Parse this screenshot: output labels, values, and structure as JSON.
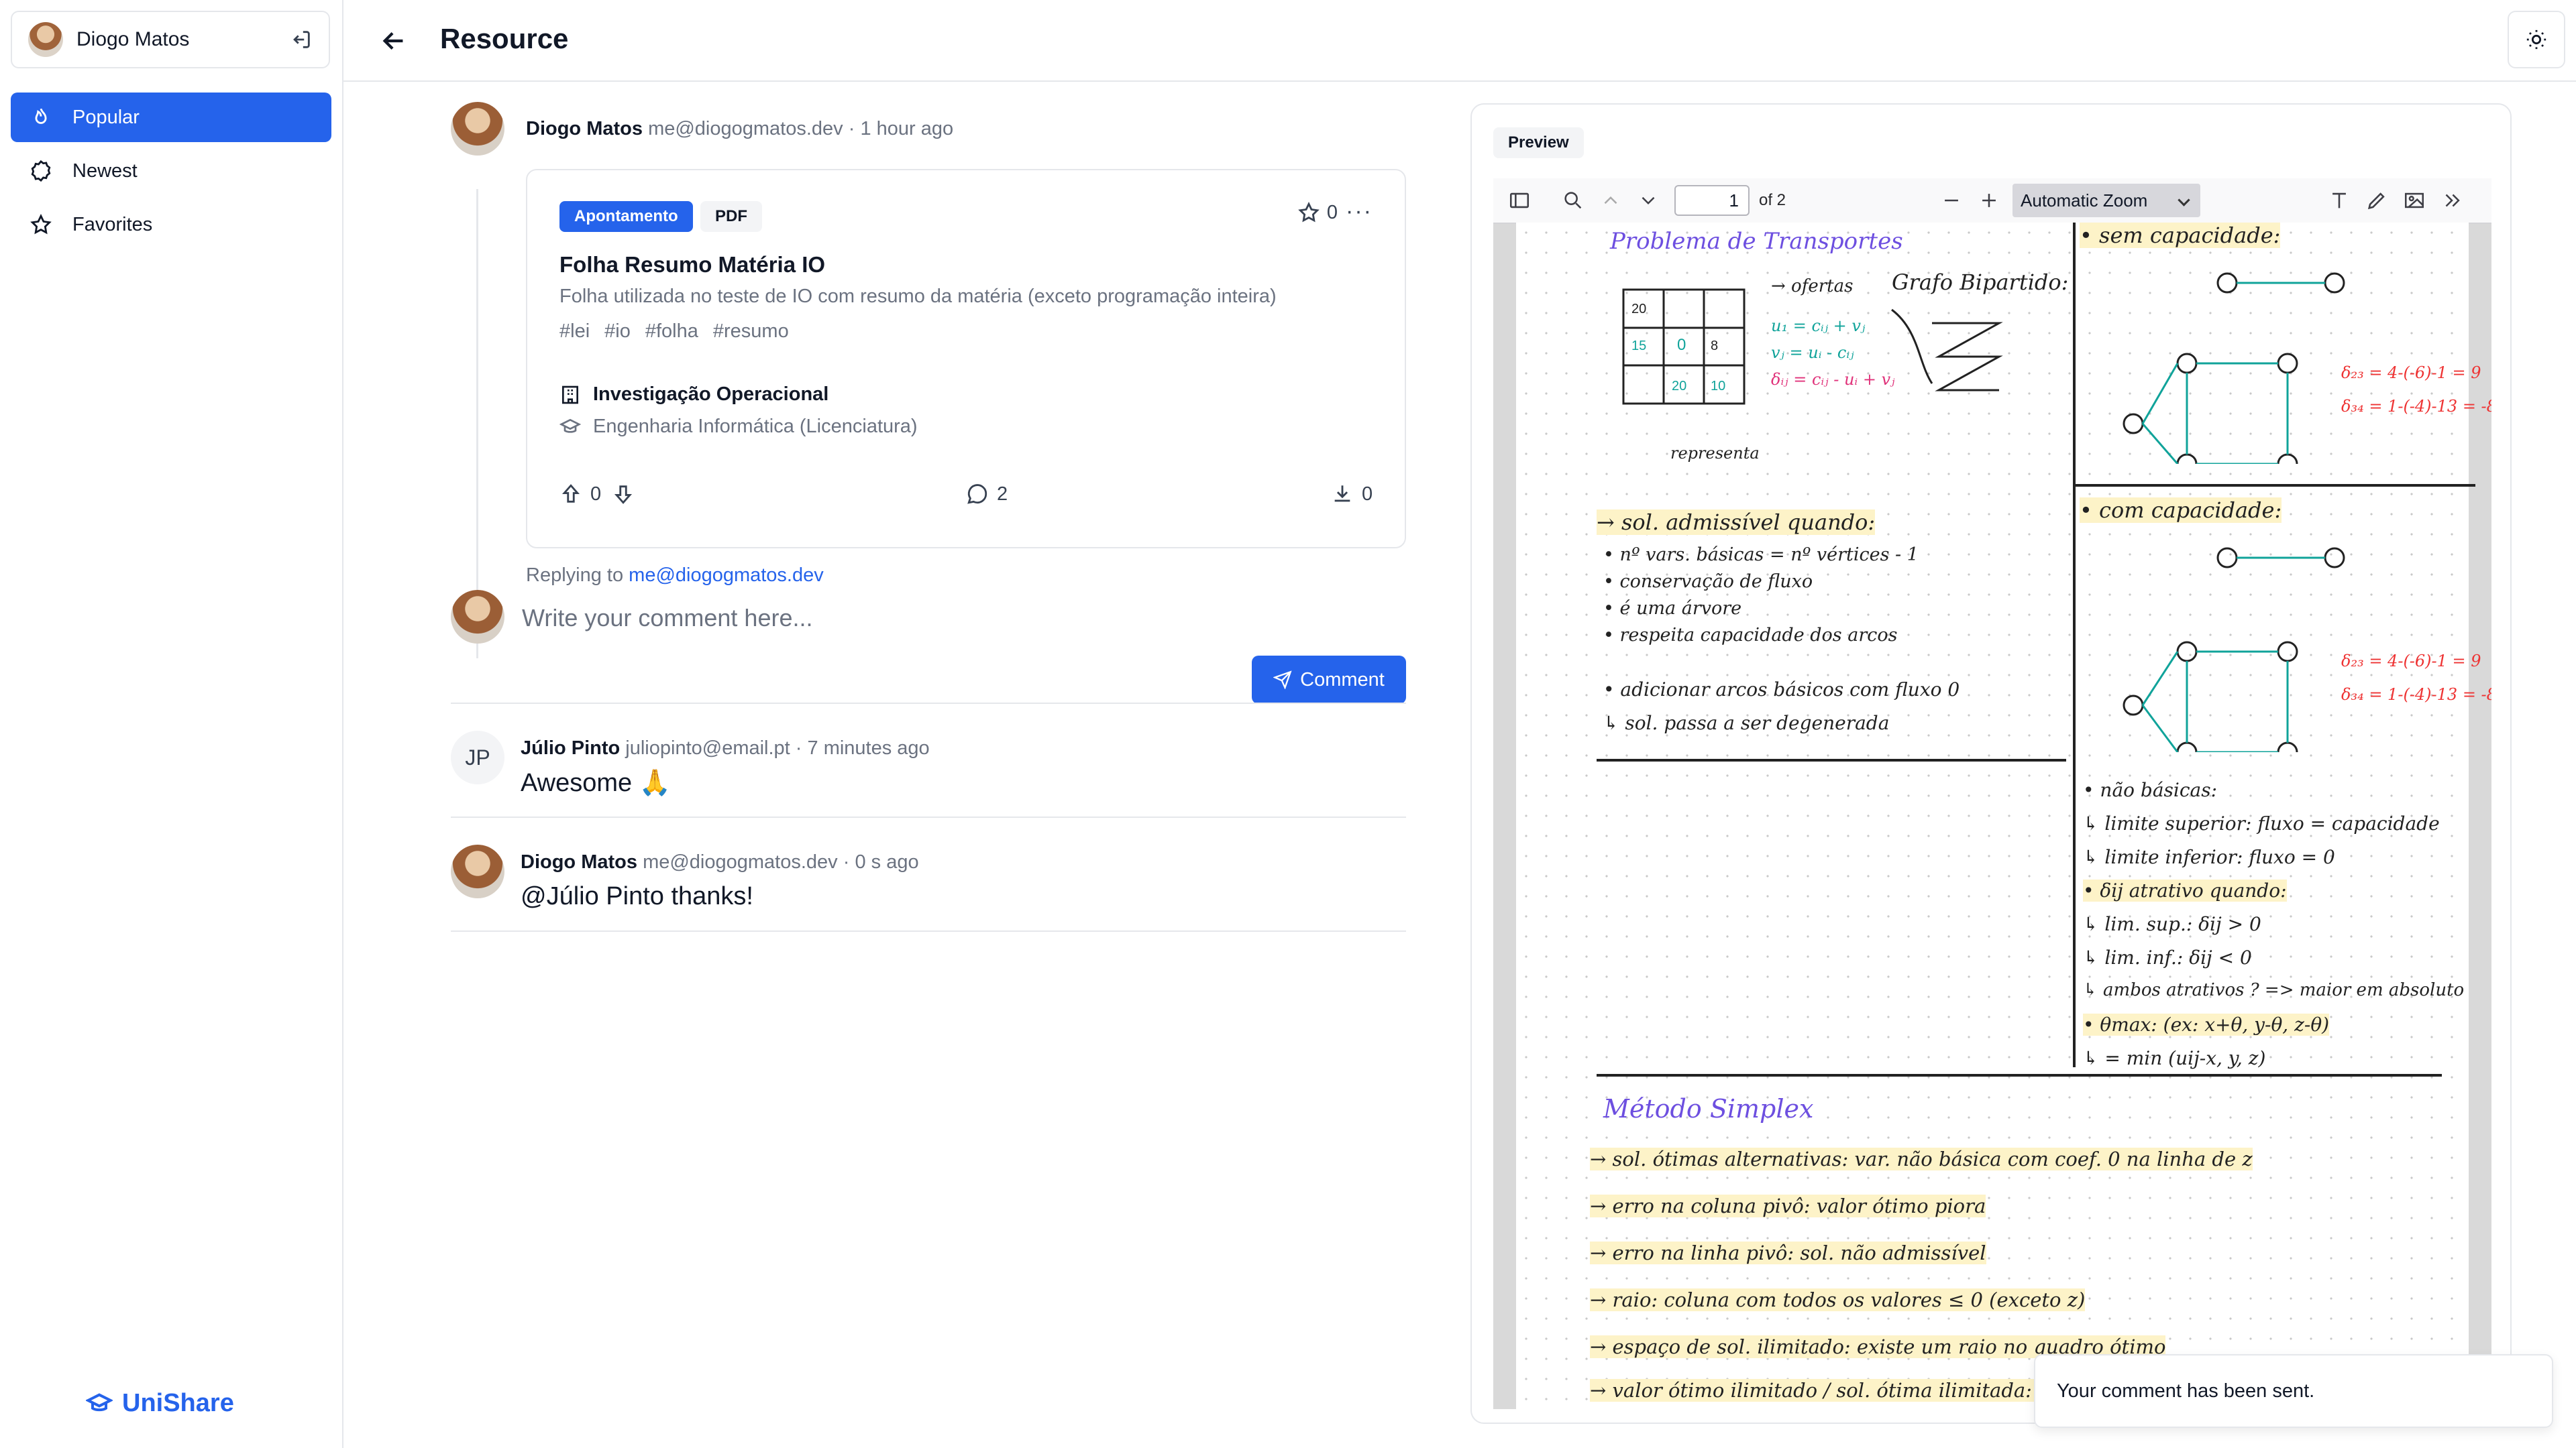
{
  "sidebar": {
    "user_name": "Diogo Matos",
    "nav": [
      {
        "label": "Popular",
        "icon": "flame-icon",
        "active": true
      },
      {
        "label": "Newest",
        "icon": "badge-icon",
        "active": false
      },
      {
        "label": "Favorites",
        "icon": "star-icon",
        "active": false
      }
    ],
    "brand": "UniShare"
  },
  "header": {
    "title": "Resource"
  },
  "post": {
    "author": "Diogo Matos",
    "email": "me@diogogmatos.dev",
    "time": "· 1 hour ago",
    "badge_type": "Apontamento",
    "badge_format": "PDF",
    "favorites": "0",
    "title": "Folha Resumo Matéria IO",
    "description": "Folha utilizada no teste de IO com resumo da matéria (exceto programação inteira)",
    "tags": [
      "#lei",
      "#io",
      "#folha",
      "#resumo"
    ],
    "course": "Investigação Operacional",
    "degree": "Engenharia Informática (Licenciatura)",
    "upvotes": "0",
    "comments": "2",
    "downloads": "0"
  },
  "reply": {
    "prefix": "Replying to",
    "target": "me@diogogmatos.dev",
    "placeholder": "Write your comment here...",
    "button": "Comment"
  },
  "comments": [
    {
      "initials": "JP",
      "author": "Júlio Pinto",
      "email": "juliopinto@email.pt",
      "time": "· 7 minutes ago",
      "body": "Awesome 🙏"
    },
    {
      "author": "Diogo Matos",
      "email": "me@diogogmatos.dev",
      "time": "· 0 s ago",
      "body": "@Júlio Pinto thanks!"
    }
  ],
  "preview": {
    "label": "Preview",
    "page": "1",
    "of": "of 2",
    "zoom": "Automatic Zoom"
  },
  "doc": {
    "heading1": "Problema de Transportes",
    "grafo": "Grafo Bipartido:",
    "sem_capacidade": "• sem capacidade:",
    "com_capacidade": "• com capacidade:",
    "sol_admissivel": "→ sol. admissível quando:",
    "bullets1": [
      "• nº vars. básicas = nº vértices - 1",
      "• conservação de fluxo",
      "• é uma árvore",
      "• respeita capacidade dos arcos"
    ],
    "adicionar": "• adicionar arcos básicos com fluxo 0",
    "degenerada": "↳ sol. passa a ser degenerada",
    "nao_basicas": "• não básicas:",
    "limite_sup": "↳ limite superior: fluxo = capacidade",
    "limite_inf": "↳ limite inferior: fluxo = 0",
    "dij": "• δij atrativo quando:",
    "lim_sup": "↳ lim. sup.: δij > 0",
    "lim_inf": "↳ lim. inf.: δij < 0",
    "ambos": "↳ ambos atrativos ? => maior em absoluto",
    "theta": "• θmax: (ex: x+θ, y-θ, z-θ)",
    "theta_min": "↳ = min (uij-x, y, z)",
    "simplex": "Método Simplex",
    "simplex_lines": [
      "→ sol. ótimas alternativas: var. não básica com coef. 0 na linha de z",
      "→ erro na coluna pivô: valor ótimo piora",
      "→ erro na linha pivô: sol. não admissível",
      "→ raio: coluna com todos os valores ≤ 0 (exceto z)",
      "→ espaço de sol. ilimitado: existe um raio no quadro ótimo",
      "→ valor ótimo ilimitado / sol. ótima ilimitada: raio"
    ]
  },
  "toast": {
    "message": "Your comment has been sent."
  }
}
